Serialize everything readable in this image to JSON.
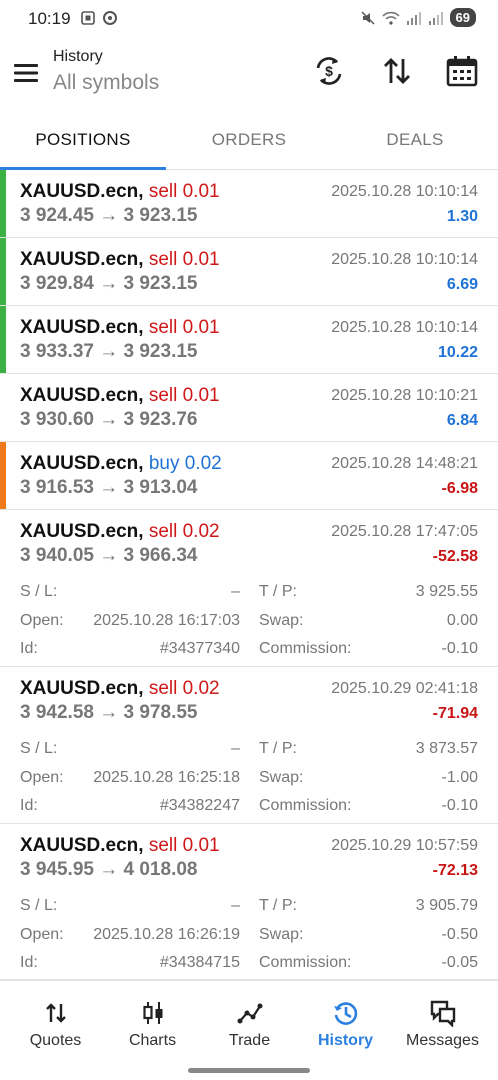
{
  "status": {
    "time": "10:19",
    "battery": "69"
  },
  "header": {
    "title": "History",
    "subtitle": "All symbols"
  },
  "tabs": [
    {
      "label": "POSITIONS"
    },
    {
      "label": "ORDERS"
    },
    {
      "label": "DEALS"
    }
  ],
  "labels": {
    "sl": "S / L:",
    "tp": "T / P:",
    "open": "Open:",
    "swap": "Swap:",
    "id": "Id:",
    "commission": "Commission:"
  },
  "rows": [
    {
      "symbol": "XAUUSD.ecn,",
      "direction": "sell 0.01",
      "prices": "3 924.45 → 3 923.15",
      "time": "2025.10.28 10:10:14",
      "profit": "1.30"
    },
    {
      "symbol": "XAUUSD.ecn,",
      "direction": "sell 0.01",
      "prices": "3 929.84 → 3 923.15",
      "time": "2025.10.28 10:10:14",
      "profit": "6.69"
    },
    {
      "symbol": "XAUUSD.ecn,",
      "direction": "sell 0.01",
      "prices": "3 933.37 → 3 923.15",
      "time": "2025.10.28 10:10:14",
      "profit": "10.22"
    },
    {
      "symbol": "XAUUSD.ecn,",
      "direction": "sell 0.01",
      "prices": "3 930.60 → 3 923.76",
      "time": "2025.10.28 10:10:21",
      "profit": "6.84"
    },
    {
      "symbol": "XAUUSD.ecn,",
      "direction": "buy 0.02",
      "prices": "3 916.53 → 3 913.04",
      "time": "2025.10.28 14:48:21",
      "profit": "-6.98"
    },
    {
      "symbol": "XAUUSD.ecn,",
      "direction": "sell 0.02",
      "prices": "3 940.05 → 3 966.34",
      "time": "2025.10.28 17:47:05",
      "profit": "-52.58",
      "sl": "–",
      "tp": "3 925.55",
      "open": "2025.10.28 16:17:03",
      "swap": "0.00",
      "id": "#34377340",
      "commission": "-0.10"
    },
    {
      "symbol": "XAUUSD.ecn,",
      "direction": "sell 0.02",
      "prices": "3 942.58 → 3 978.55",
      "time": "2025.10.29 02:41:18",
      "profit": "-71.94",
      "sl": "–",
      "tp": "3 873.57",
      "open": "2025.10.28 16:25:18",
      "swap": "-1.00",
      "id": "#34382247",
      "commission": "-0.10"
    },
    {
      "symbol": "XAUUSD.ecn,",
      "direction": "sell 0.01",
      "prices": "3 945.95 → 4 018.08",
      "time": "2025.10.29 10:57:59",
      "profit": "-72.13",
      "sl": "–",
      "tp": "3 905.79",
      "open": "2025.10.28 16:26:19",
      "swap": "-0.50",
      "id": "#34384715",
      "commission": "-0.05"
    }
  ],
  "nav": [
    {
      "label": "Quotes",
      "icon": "quotes-arrows-icon"
    },
    {
      "label": "Charts",
      "icon": "candlestick-icon"
    },
    {
      "label": "Trade",
      "icon": "trade-line-icon"
    },
    {
      "label": "History",
      "icon": "history-clock-icon"
    },
    {
      "label": "Messages",
      "icon": "messages-icon"
    }
  ],
  "colors": {
    "accent": "#2d80e0",
    "sell": "#d01818",
    "buy": "#1f72d6",
    "profit_positive": "#1f72d6",
    "profit_negative": "#c81414",
    "bar_green": "#3cb043",
    "bar_orange": "#f07a1a"
  }
}
